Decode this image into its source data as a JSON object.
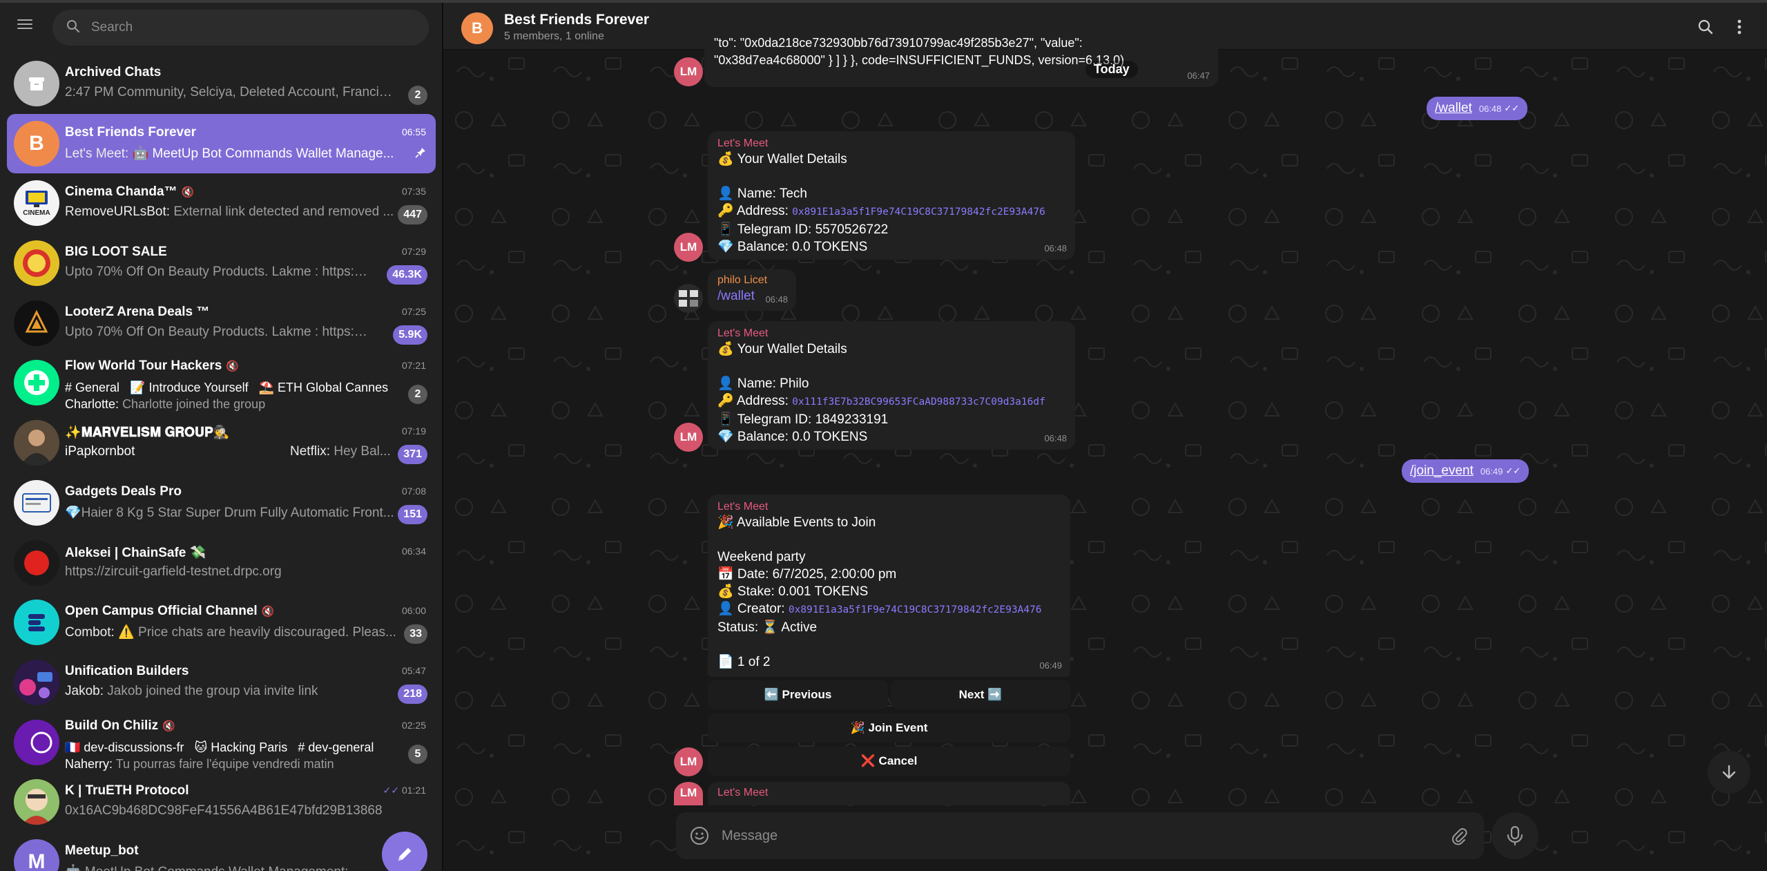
{
  "sidebar": {
    "search_placeholder": "Search",
    "chats": [
      {
        "title": "Archived Chats",
        "time": "",
        "subtitle": "2:47 PM Community, Selciya, Deleted Account, Francis S...",
        "badge": "2",
        "badge_style": "gray",
        "avatar_color": "#c6c6c6",
        "avatar_text": ""
      },
      {
        "title": "Best Friends Forever",
        "time": "06:55",
        "sender": "Let's Meet:",
        "subtitle": "🤖 MeetUp Bot Commands Wallet Manage...",
        "badge": "",
        "avatar_color": "#f08a4b",
        "avatar_text": "B",
        "active": true
      },
      {
        "title": "Cinema Chanda™",
        "time": "07:35",
        "sender": "RemoveURLsBot:",
        "subtitle": "External link detected and removed ...",
        "badge": "447",
        "badge_style": "gray",
        "avatar_color": "#e8e8e8",
        "avatar_text": ""
      },
      {
        "title": "BIG LOOT SALE",
        "time": "07:29",
        "subtitle": "Upto 70% Off On Beauty Products. Lakme : https://a...",
        "badge": "46.3K",
        "badge_style": "blue",
        "avatar_color": "#e3c126",
        "avatar_text": ""
      },
      {
        "title": "LooterZ Arena Deals ™",
        "time": "07:25",
        "subtitle": "Upto 70% Off On Beauty Products. Lakme : https://a...",
        "badge": "5.9K",
        "badge_style": "blue",
        "avatar_color": "#111111",
        "avatar_text": ""
      },
      {
        "title": "Flow World Tour Hackers",
        "time": "07:21",
        "topics": [
          "# General",
          "📝 Introduce Yourself",
          "⛱️ ETH Global Cannes"
        ],
        "sender": "Charlotte:",
        "subtitle": "Charlotte joined the group",
        "badge": "2",
        "badge_style": "gray",
        "avatar_color": "#00ef8b",
        "avatar_text": ""
      },
      {
        "title": "✨𝐌𝐀𝐑𝐕𝐄𝐋𝐈𝐒𝐌 𝐆𝐑𝐎𝐔𝐏🕵️",
        "time": "07:19",
        "subtitle": "iPapkornbot",
        "subtitle_right_sender": "Netflix:",
        "subtitle_right": "Hey Bal...",
        "badge": "371",
        "badge_style": "blue",
        "avatar_color": "#5a4a3a",
        "avatar_text": ""
      },
      {
        "title": "Gadgets Deals Pro",
        "time": "07:08",
        "subtitle": "💎Haier 8 Kg 5 Star Super Drum Fully Automatic Front...",
        "badge": "151",
        "badge_style": "blue",
        "avatar_color": "#f2f2f2",
        "avatar_text": ""
      },
      {
        "title": "Aleksei | ChainSafe 💸",
        "time": "06:34",
        "subtitle": "https://zircuit-garfield-testnet.drpc.org",
        "badge": "",
        "avatar_color": "#1a1a1a",
        "avatar_text": ""
      },
      {
        "title": "Open Campus Official Channel",
        "time": "06:00",
        "sender": "Combot:",
        "subtitle": "⚠️ Price chats are heavily discouraged. Pleas...",
        "badge": "33",
        "badge_style": "gray",
        "avatar_color": "#13d0d0",
        "avatar_text": ""
      },
      {
        "title": "Unification Builders",
        "time": "05:47",
        "sender": "Jakob:",
        "subtitle": "Jakob joined the group via invite link",
        "badge": "218",
        "badge_style": "blue",
        "avatar_color": "#2b1a4a",
        "avatar_text": ""
      },
      {
        "title": "Build On Chiliz",
        "time": "02:25",
        "topics": [
          "🇫🇷 dev-discussions-fr",
          "🐱 Hacking Paris",
          "# dev-general"
        ],
        "sender": "Naherry:",
        "subtitle": "Tu pourras faire l'équipe vendredi matin",
        "badge": "5",
        "badge_style": "gray",
        "avatar_color": "#6a1bb0",
        "avatar_text": ""
      },
      {
        "title": "K | TruETH Protocol",
        "time": "01:21",
        "subtitle": "0x16AC9b468DC98FeF41556A4B61E47bfd29B13868",
        "badge": "",
        "avatar_color": "#8fbf6a",
        "avatar_text": ""
      },
      {
        "title": "Meetup_bot",
        "time": "",
        "subtitle": "🤖 MeetUp Bot Commands Wallet Management: • /crea...",
        "badge": "",
        "avatar_color": "#7e6bd6",
        "avatar_text": "M"
      }
    ]
  },
  "chat": {
    "title": "Best Friends Forever",
    "status": "5 members, 1 online",
    "avatar_letter": "B",
    "today_label": "Today",
    "error_text_1": "\"to\": \"0x0da218ce732930bb76d73910799ac49f285b3e27\", \"value\":",
    "error_text_2": "\"0x38d7ea4c68000\" } ] } }, code=INSUFFICIENT_FUNDS, version=6.13.0)",
    "error_time": "06:47",
    "out1": {
      "text": "/wallet",
      "time": "06:48"
    },
    "wallet1": {
      "sender": "Let's Meet",
      "heading": "💰 Your Wallet Details",
      "name": "👤 Name: Tech",
      "address_label": "🔑 Address:",
      "address": "0x891E1a3a5f1F9e74C19C8C371798​42fc2E93A476",
      "telegram": "📱 Telegram ID: 5570526722",
      "balance": "💎 Balance: 0.0 TOKENS",
      "time": "06:48"
    },
    "philo": {
      "sender": "philo Licet",
      "text": "/wallet",
      "time": "06:48"
    },
    "wallet2": {
      "sender": "Let's Meet",
      "heading": "💰 Your Wallet Details",
      "name": "👤 Name: Philo",
      "address_label": "🔑 Address:",
      "address": "0x111f3E7b32BC99653FCaAD988733c7C09d3a16df",
      "telegram": "📱 Telegram ID: 1849233191",
      "balance": "💎 Balance: 0.0 TOKENS",
      "time": "06:48"
    },
    "out2": {
      "text": "/join_event",
      "time": "06:49"
    },
    "events": {
      "sender": "Let's Meet",
      "heading": "🎉 Available Events to Join",
      "event_name": "Weekend party",
      "date": "📅 Date: 6/7/2025, 2:00:00 pm",
      "stake": "💰 Stake: 0.001 TOKENS",
      "creator_label": "👤 Creator:",
      "creator": "0x891E1a3a5f1F9e74C19C8C371798​42fc2E93A476",
      "status": "Status: ⏳ Active",
      "page": "📄 1 of 2",
      "time": "06:49",
      "btn_prev": "⬅️ Previous",
      "btn_next": "Next ➡️",
      "btn_join": "🎉 Join Event",
      "btn_cancel": "❌ Cancel"
    },
    "last_sender": "Let's Meet",
    "lm_initials": "LM",
    "composer_placeholder": "Message"
  }
}
